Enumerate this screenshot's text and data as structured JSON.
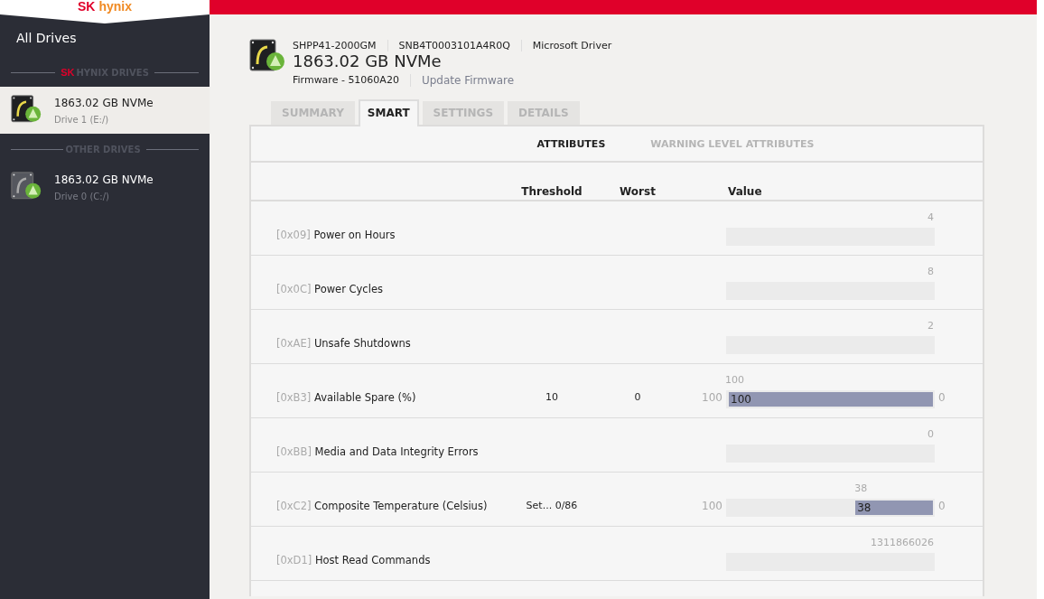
{
  "sidebar": {
    "logo": {
      "brand": "SK",
      "name": "hynix"
    },
    "all_drives": "All Drives",
    "sections": [
      {
        "title": "HYNIX DRIVES",
        "brand": "SK",
        "drives": [
          {
            "name": "1863.02 GB NVMe",
            "sub": "Drive 1 (E:/)",
            "selected": true
          }
        ]
      },
      {
        "title": "OTHER DRIVES",
        "drives": [
          {
            "name": "1863.02 GB NVMe",
            "sub": "Drive 0 (C:/)",
            "selected": false
          }
        ]
      }
    ]
  },
  "drive_header": {
    "info": [
      "SHPP41-2000GM",
      "SNB4T0003101A4R0Q",
      "Microsoft Driver"
    ],
    "title": "1863.02 GB NVMe",
    "firmware": "Firmware - 51060A20",
    "update_link": "Update Firmware"
  },
  "tabs": [
    {
      "label": "SUMMARY",
      "selected": false
    },
    {
      "label": "SMART",
      "selected": true
    },
    {
      "label": "SETTINGS",
      "selected": false
    },
    {
      "label": "DETAILS",
      "selected": false
    }
  ],
  "subtabs": [
    {
      "label": "ATTRIBUTES",
      "selected": true
    },
    {
      "label": "WARNING LEVEL ATTRIBUTES",
      "selected": false
    }
  ],
  "table": {
    "columns": [
      "Threshold",
      "Worst",
      "Value"
    ],
    "rows": [
      {
        "id": "[0x09]",
        "name": "Power on Hours",
        "kind": "counter",
        "value": "4"
      },
      {
        "id": "[0x0C]",
        "name": "Power Cycles",
        "kind": "counter",
        "value": "8"
      },
      {
        "id": "[0xAE]",
        "name": "Unsafe Shutdowns",
        "kind": "counter",
        "value": "2"
      },
      {
        "id": "[0xB3]",
        "name": "Available Spare (%)",
        "kind": "gauge",
        "threshold": "10",
        "worst": "0",
        "value": "100",
        "min": "100",
        "max": "0",
        "level": 1,
        "bar_label": "100"
      },
      {
        "id": "[0xBB]",
        "name": "Media and Data Integrity Errors",
        "kind": "counter",
        "value": "0"
      },
      {
        "id": "[0xC2]",
        "name": "Composite Temperature (Celsius)",
        "kind": "gauge",
        "threshold": "Set... 0/86",
        "value": "38",
        "min": "100",
        "max": "0",
        "level": 0.38,
        "bar_label": "38"
      },
      {
        "id": "[0xD1]",
        "name": "Host Read Commands",
        "kind": "counter",
        "value": "1311866026"
      }
    ]
  }
}
